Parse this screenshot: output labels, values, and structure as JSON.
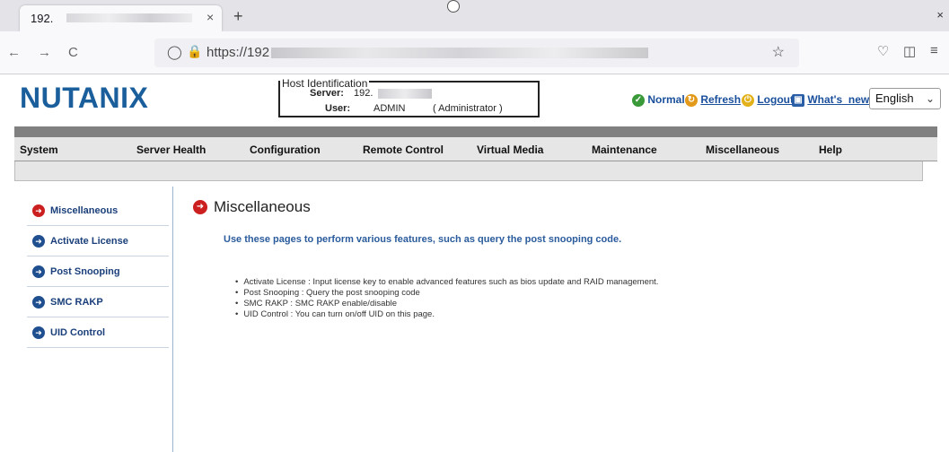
{
  "browser": {
    "tab_title": "192.",
    "tab_close": "×",
    "new_tab": "+",
    "window_close": "×",
    "url_prefix": "https://192",
    "back_icon": "←",
    "forward_icon": "→",
    "reload_icon": "C",
    "star_icon": "☆",
    "pocket_icon": "♡",
    "sidebar_icon": "◫",
    "menu_icon": "≡"
  },
  "header": {
    "logo": "NUTANIX",
    "host_legend": "Host Identification",
    "server_label": "Server:",
    "server_value": "192.",
    "user_label": "User:",
    "user_value": "ADMIN",
    "user_role": "( Administrator )",
    "status_normal": "Normal",
    "refresh": "Refresh",
    "logout": "Logout",
    "whats_new": "What's_new",
    "language": "English"
  },
  "menu": [
    "System",
    "Server Health",
    "Configuration",
    "Remote Control",
    "Virtual Media",
    "Maintenance",
    "Miscellaneous",
    "Help"
  ],
  "sidebar": {
    "items": [
      {
        "label": "Miscellaneous",
        "active": true
      },
      {
        "label": "Activate License",
        "active": false
      },
      {
        "label": "Post Snooping",
        "active": false
      },
      {
        "label": "SMC RAKP",
        "active": false
      },
      {
        "label": "UID Control",
        "active": false
      }
    ]
  },
  "content": {
    "title": "Miscellaneous",
    "description": "Use these pages to perform various features, such as query the post snooping code.",
    "bullets": [
      "Activate License : Input license key to enable advanced features such as bios update and RAID management.",
      "Post Snooping : Query the post snooping code",
      "SMC RAKP : SMC RAKP enable/disable",
      "UID Control : You can turn on/off UID on this page."
    ]
  },
  "colors": {
    "brand": "#1a5f9c",
    "active_icon": "#cc1f1f",
    "inactive_icon": "#1f4f8f"
  }
}
